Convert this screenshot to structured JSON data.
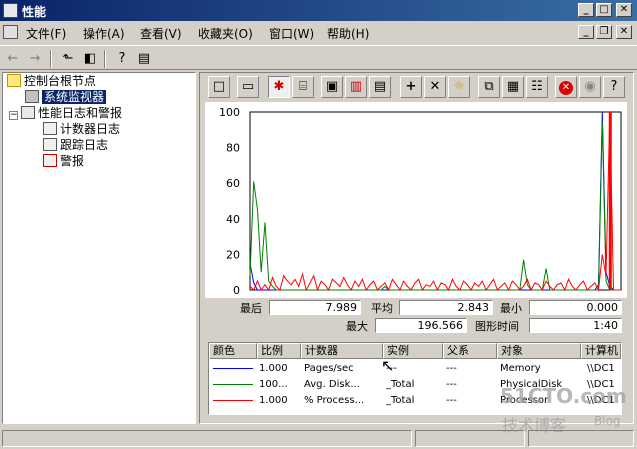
{
  "window": {
    "title": "性能",
    "min": "_",
    "max": "□",
    "close": "✕"
  },
  "menu": [
    "文件(F)",
    "操作(A)",
    "查看(V)",
    "收藏夹(O)",
    "窗口(W)",
    "帮助(H)"
  ],
  "tree": {
    "root": "控制台根节点",
    "system_monitor": "系统监视器",
    "logs": "性能日志和警报",
    "counter_logs": "计数器日志",
    "trace_logs": "跟踪日志",
    "alerts": "警报"
  },
  "stats": {
    "last_label": "最后",
    "last": "7.989",
    "avg_label": "平均",
    "avg": "2.843",
    "min_label": "最小",
    "min": "0.000",
    "max_label": "最大",
    "max": "196.566",
    "duration_label": "图形时间",
    "duration": "1:40"
  },
  "legend": {
    "headers": [
      "颜色",
      "比例",
      "计数器",
      "实例",
      "父系",
      "对象",
      "计算机"
    ],
    "rows": [
      {
        "color": "#0000ff",
        "scale": "1.000",
        "counter": "Pages/sec",
        "instance": "---",
        "parent": "---",
        "object": "Memory",
        "computer": "\\\\DC1"
      },
      {
        "color": "#008000",
        "scale": "100...",
        "counter": "Avg. Disk...",
        "instance": "_Total",
        "parent": "---",
        "object": "PhysicalDisk",
        "computer": "\\\\DC1"
      },
      {
        "color": "#ff0000",
        "scale": "1.000",
        "counter": "% Process...",
        "instance": "_Total",
        "parent": "---",
        "object": "Processor",
        "computer": "\\\\DC1"
      }
    ]
  },
  "watermark": {
    "site": "51CTO.com",
    "sub": "技术博客",
    "blog": "Blog"
  },
  "chart_data": {
    "type": "line",
    "ylim": [
      0,
      100
    ],
    "yticks": [
      "100",
      "80",
      "60",
      "40",
      "20",
      "0"
    ],
    "x": [
      0,
      1,
      2,
      3,
      4,
      5,
      6,
      7,
      8,
      9,
      10,
      11,
      12,
      13,
      14,
      15,
      16,
      17,
      18,
      19,
      20,
      21,
      22,
      23,
      24,
      25,
      26,
      27,
      28,
      29,
      30,
      31,
      32,
      33,
      34,
      35,
      36,
      37,
      38,
      39,
      40,
      41,
      42,
      43,
      44,
      45,
      46,
      47,
      48,
      49,
      50,
      51,
      52,
      53,
      54,
      55,
      56,
      57,
      58,
      59,
      60,
      61,
      62,
      63,
      64,
      65,
      66,
      67,
      68,
      69,
      70,
      71,
      72,
      73,
      74,
      75,
      76,
      77,
      78,
      79,
      80,
      81,
      82,
      83,
      84,
      85,
      86,
      87,
      88,
      89,
      90,
      91,
      92,
      93,
      94,
      95,
      96,
      97,
      98,
      99
    ],
    "series": [
      {
        "name": "Pages/sec",
        "color": "#0000ff",
        "values": [
          15,
          4,
          0,
          0,
          0,
          0,
          0,
          0,
          0,
          0,
          0,
          0,
          0,
          0,
          0,
          0,
          0,
          0,
          0,
          0,
          0,
          0,
          0,
          0,
          0,
          0,
          0,
          0,
          0,
          0,
          0,
          0,
          0,
          0,
          0,
          0,
          0,
          0,
          0,
          0,
          0,
          0,
          0,
          0,
          0,
          0,
          0,
          0,
          0,
          0,
          0,
          0,
          0,
          0,
          0,
          0,
          0,
          0,
          0,
          0,
          0,
          0,
          0,
          0,
          0,
          0,
          0,
          0,
          0,
          0,
          0,
          0,
          0,
          0,
          0,
          0,
          0,
          0,
          0,
          0,
          0,
          0,
          0,
          0,
          0,
          0,
          0,
          0,
          0,
          0,
          0,
          0,
          0,
          3,
          100,
          10,
          2,
          0,
          0,
          0
        ]
      },
      {
        "name": "Avg. Disk...",
        "color": "#008000",
        "values": [
          8,
          61,
          45,
          10,
          38,
          5,
          2,
          0,
          0,
          0,
          0,
          0,
          0,
          0,
          0,
          0,
          0,
          0,
          0,
          0,
          0,
          0,
          0,
          0,
          0,
          0,
          0,
          0,
          0,
          0,
          0,
          0,
          0,
          0,
          0,
          0,
          2,
          0,
          0,
          0,
          0,
          0,
          0,
          0,
          0,
          0,
          0,
          0,
          0,
          0,
          0,
          0,
          0,
          0,
          0,
          0,
          0,
          0,
          0,
          0,
          0,
          0,
          0,
          0,
          0,
          0,
          0,
          0,
          0,
          0,
          0,
          0,
          0,
          17,
          3,
          0,
          0,
          0,
          0,
          12,
          0,
          0,
          0,
          0,
          0,
          0,
          0,
          0,
          0,
          0,
          0,
          0,
          0,
          0,
          95,
          5,
          0,
          0,
          0,
          0
        ]
      },
      {
        "name": "% Process...",
        "color": "#ff0000",
        "values": [
          2,
          0,
          5,
          0,
          3,
          0,
          7,
          2,
          0,
          8,
          5,
          3,
          6,
          2,
          9,
          0,
          4,
          8,
          0,
          5,
          3,
          0,
          6,
          4,
          2,
          7,
          3,
          0,
          5,
          2,
          6,
          0,
          3,
          5,
          0,
          2,
          4,
          0,
          6,
          3,
          0,
          5,
          2,
          0,
          4,
          6,
          0,
          3,
          2,
          5,
          0,
          4,
          3,
          0,
          6,
          2,
          0,
          5,
          3,
          0,
          4,
          2,
          5,
          0,
          3,
          6,
          0,
          2,
          4,
          0,
          5,
          3,
          0,
          2,
          6,
          0,
          4,
          3,
          0,
          5,
          2,
          0,
          3,
          4,
          0,
          6,
          2,
          0,
          3,
          5,
          0,
          2,
          4,
          0,
          20,
          8,
          100,
          0,
          0,
          0
        ]
      }
    ]
  }
}
